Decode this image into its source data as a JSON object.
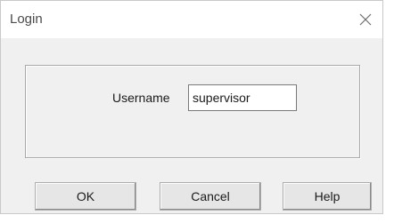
{
  "window": {
    "title": "Login",
    "close_icon": "close-icon"
  },
  "form": {
    "username_label": "Username",
    "username_value": "supervisor"
  },
  "buttons": {
    "ok_label": "OK",
    "cancel_label": "Cancel",
    "help_label": "Help"
  }
}
